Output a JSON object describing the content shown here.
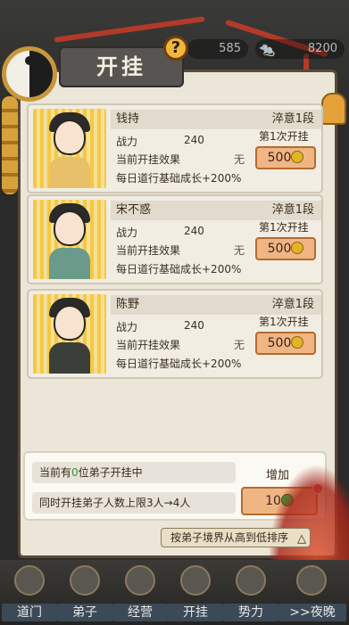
{
  "header": {
    "title": "开挂",
    "help_glyph": "?",
    "resource1": "585",
    "resource2": "8200"
  },
  "disciples": [
    {
      "name": "钱持",
      "realm": "淬意1段",
      "power_label": "战力",
      "power_value": "240",
      "effect_label": "当前开挂效果",
      "effect_value": "无",
      "growth": "每日道行基础成长+200%",
      "times": "第1次开挂",
      "cost": "500"
    },
    {
      "name": "宋不惑",
      "realm": "淬意1段",
      "power_label": "战力",
      "power_value": "240",
      "effect_label": "当前开挂效果",
      "effect_value": "无",
      "growth": "每日道行基础成长+200%",
      "times": "第1次开挂",
      "cost": "500"
    },
    {
      "name": "陈野",
      "realm": "淬意1段",
      "power_label": "战力",
      "power_value": "240",
      "effect_label": "当前开挂效果",
      "effect_value": "无",
      "growth": "每日道行基础成长+200%",
      "times": "第1次开挂",
      "cost": "500"
    }
  ],
  "panel": {
    "current_prefix": "当前有",
    "current_count": "0",
    "current_suffix": "位弟子开挂中",
    "limit_text": "同时开挂弟子人数上限3人→4人",
    "increase_label": "增加",
    "increase_cost": "10"
  },
  "sort_label": "按弟子境界从高到低排序",
  "tabs": [
    "道门",
    "弟子",
    "经营",
    "开挂",
    "势力",
    ">>夜晚"
  ],
  "colors": {
    "accent": "#f0b585",
    "gold": "#f6c842",
    "tab_bg": "#3c4a58"
  }
}
